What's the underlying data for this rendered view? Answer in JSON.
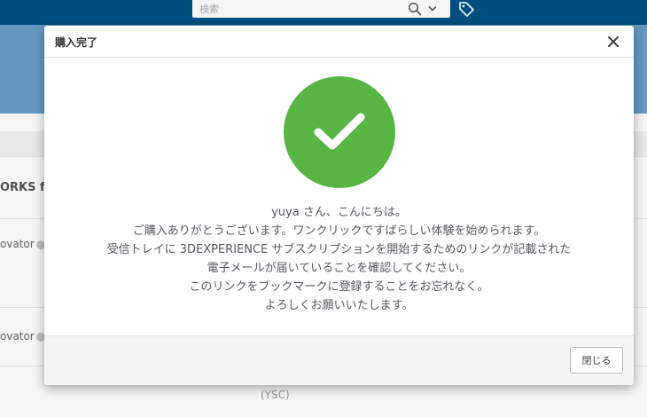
{
  "topbar": {
    "search": {
      "placeholder": "検索",
      "value": ""
    },
    "icons": [
      "search-icon",
      "chevron-down-icon",
      "tag-icon"
    ]
  },
  "background": {
    "product_fragment": "ORKS fo",
    "role_label_1": "ovator",
    "role_label_2": "ovator",
    "company_code": "(YSC)"
  },
  "modal": {
    "title": "購入完了",
    "close_icon": "close-icon",
    "success_icon": "check-icon",
    "message": {
      "greeting": "yuya さん、こんにちは。",
      "line1": "ご購入ありがとうございます。ワンクリックですばらしい体験を始められます。",
      "line2": "受信トレイに 3DEXPERIENCE サブスクリプションを開始するためのリンクが記載された",
      "line3": "電子メールが届いていることを確認してください。",
      "line4": "このリンクをブックマークに登録することをお忘れなく。",
      "line5": "よろしくお願いいたします。"
    },
    "footer": {
      "close_label": "閉じる"
    }
  },
  "colors": {
    "topbar": "#005386",
    "banner": "#6a9fc9",
    "success": "#57b543"
  }
}
